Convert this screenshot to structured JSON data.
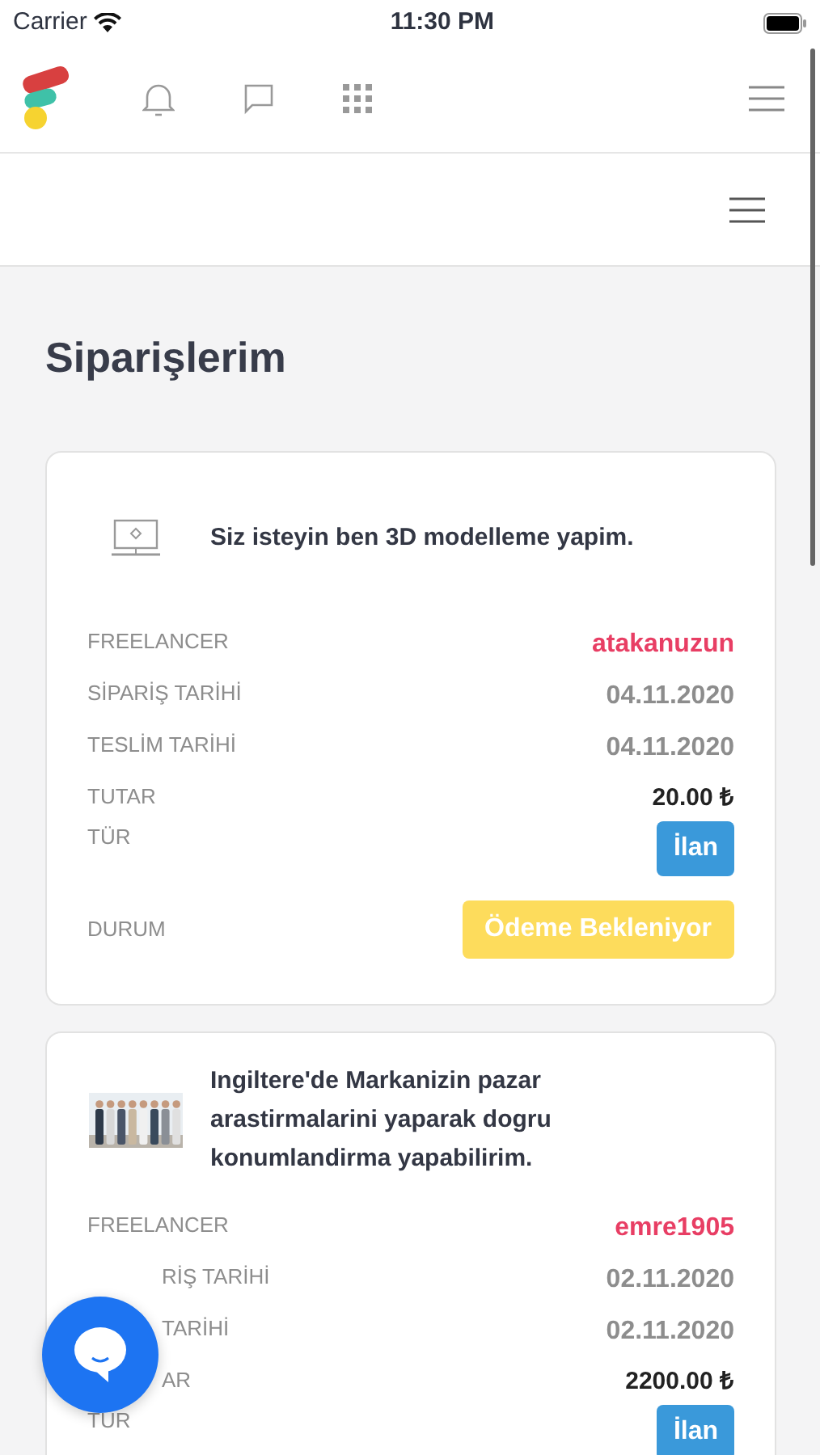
{
  "status_bar": {
    "carrier": "Carrier",
    "time": "11:30 PM"
  },
  "page_title": "Siparişlerim",
  "orders": [
    {
      "kind": "icon-thumb",
      "title": "Siz isteyin ben 3D modelleme yapim.",
      "rows": [
        {
          "kind": "user",
          "label": "FREELANCER",
          "value": "atakanuzun",
          "covered": false
        },
        {
          "kind": "date",
          "label": "SİPARİŞ TARİHİ",
          "value": "04.11.2020",
          "covered": false
        },
        {
          "kind": "date",
          "label": "TESLİM TARİHİ",
          "value": "04.11.2020",
          "covered": false
        },
        {
          "kind": "amount",
          "label": "TUTAR",
          "value": "20.00 ₺",
          "covered": false
        },
        {
          "kind": "type",
          "label": "TÜR",
          "value": "İlan",
          "covered": false
        },
        {
          "kind": "status",
          "label": "DURUM",
          "value": "Ödeme Bekleniyor",
          "covered": false
        }
      ]
    },
    {
      "kind": "picture-thumb",
      "title": "Ingiltere'de Markanizin pazar arastirmalarini yaparak dogru konumlandirma yapabilirim.",
      "rows": [
        {
          "kind": "user",
          "label": "FREELANCER",
          "value": "emre1905",
          "covered": false
        },
        {
          "kind": "date",
          "label": "RİŞ TARİHİ",
          "value": "02.11.2020",
          "covered": true
        },
        {
          "kind": "date",
          "label": "TARİHİ",
          "value": "02.11.2020",
          "covered": true
        },
        {
          "kind": "amount",
          "label": "AR",
          "value": "2200.00 ₺",
          "covered": true
        },
        {
          "kind": "type",
          "label": "TÜR",
          "value": "İlan",
          "covered": false
        }
      ]
    }
  ]
}
